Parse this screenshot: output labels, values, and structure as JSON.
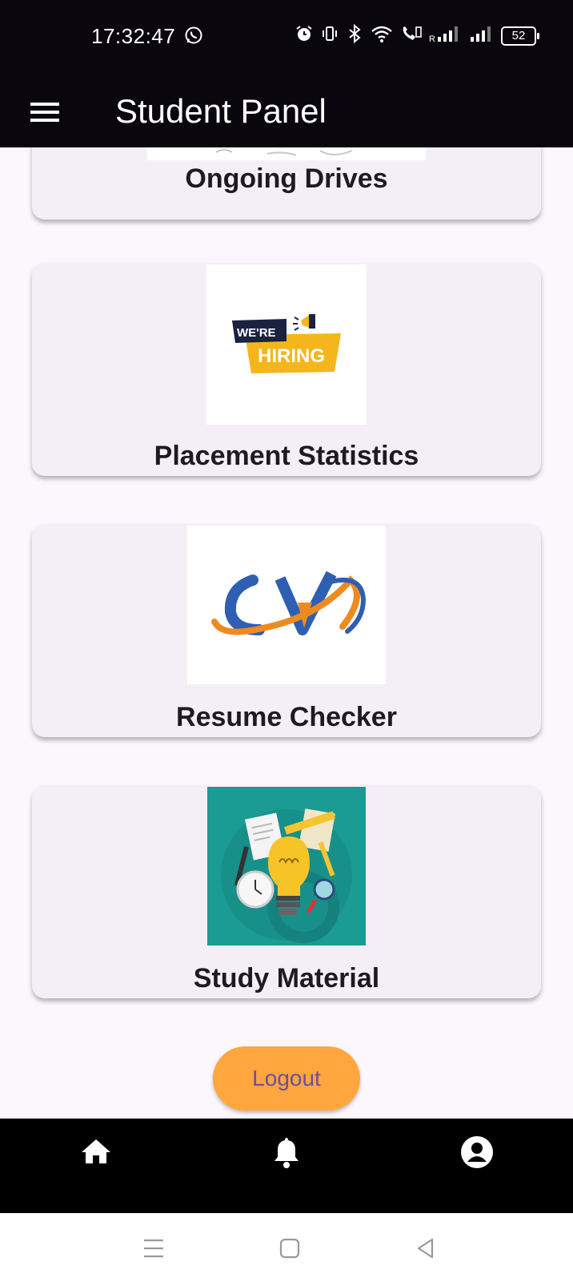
{
  "status_bar": {
    "time": "17:32:47",
    "battery": "52"
  },
  "app_bar": {
    "title": "Student Panel",
    "menu_icon": "menu-icon"
  },
  "cards": [
    {
      "label": "Ongoing Drives",
      "image": "drive-illustration"
    },
    {
      "label": "Placement Statistics",
      "image": "were-hiring-image",
      "image_text_top": "WE'RE",
      "image_text_bottom": "HIRING"
    },
    {
      "label": "Resume Checker",
      "image": "cv-logo",
      "image_text": "CV"
    },
    {
      "label": "Study Material",
      "image": "study-material-image"
    }
  ],
  "logout_label": "Logout",
  "bottom_nav": {
    "items": [
      "home-icon",
      "bell-icon",
      "account-icon"
    ]
  },
  "system_nav": [
    "menu",
    "home",
    "back"
  ],
  "colors": {
    "app_bar": "#09070d",
    "card": "#f4eff6",
    "logout_bg": "#ffa63e",
    "logout_text": "#6a4fa0",
    "hiring_yellow": "#f5b61b",
    "hiring_navy": "#1b2140",
    "cv_blue": "#2f5fb3",
    "cv_orange": "#ee8a1f",
    "study_teal": "#1a9c95"
  }
}
